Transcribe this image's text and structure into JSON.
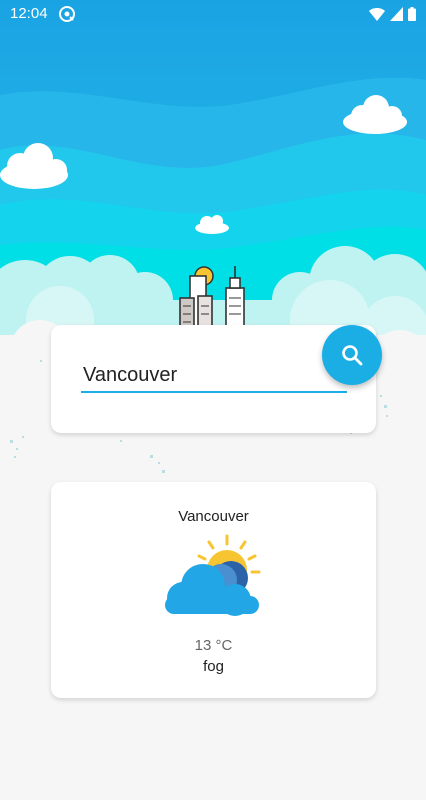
{
  "status_bar": {
    "time": "12:04",
    "icons": [
      "sync-icon",
      "wifi-icon",
      "signal-icon",
      "battery-icon"
    ]
  },
  "search": {
    "city_value": "Vancouver",
    "button_icon": "search-icon"
  },
  "weather": {
    "city": "Vancouver",
    "temperature": "13 °C",
    "description": "fog",
    "icon": "partly-cloudy-icon"
  },
  "colors": {
    "accent": "#1aaee5",
    "sky_top": "#18a9e6",
    "sky_mid": "#2cc7ea",
    "sky_light": "#00d7e6",
    "cloud": "#c3f5f4",
    "background": "#f6f6f6"
  }
}
